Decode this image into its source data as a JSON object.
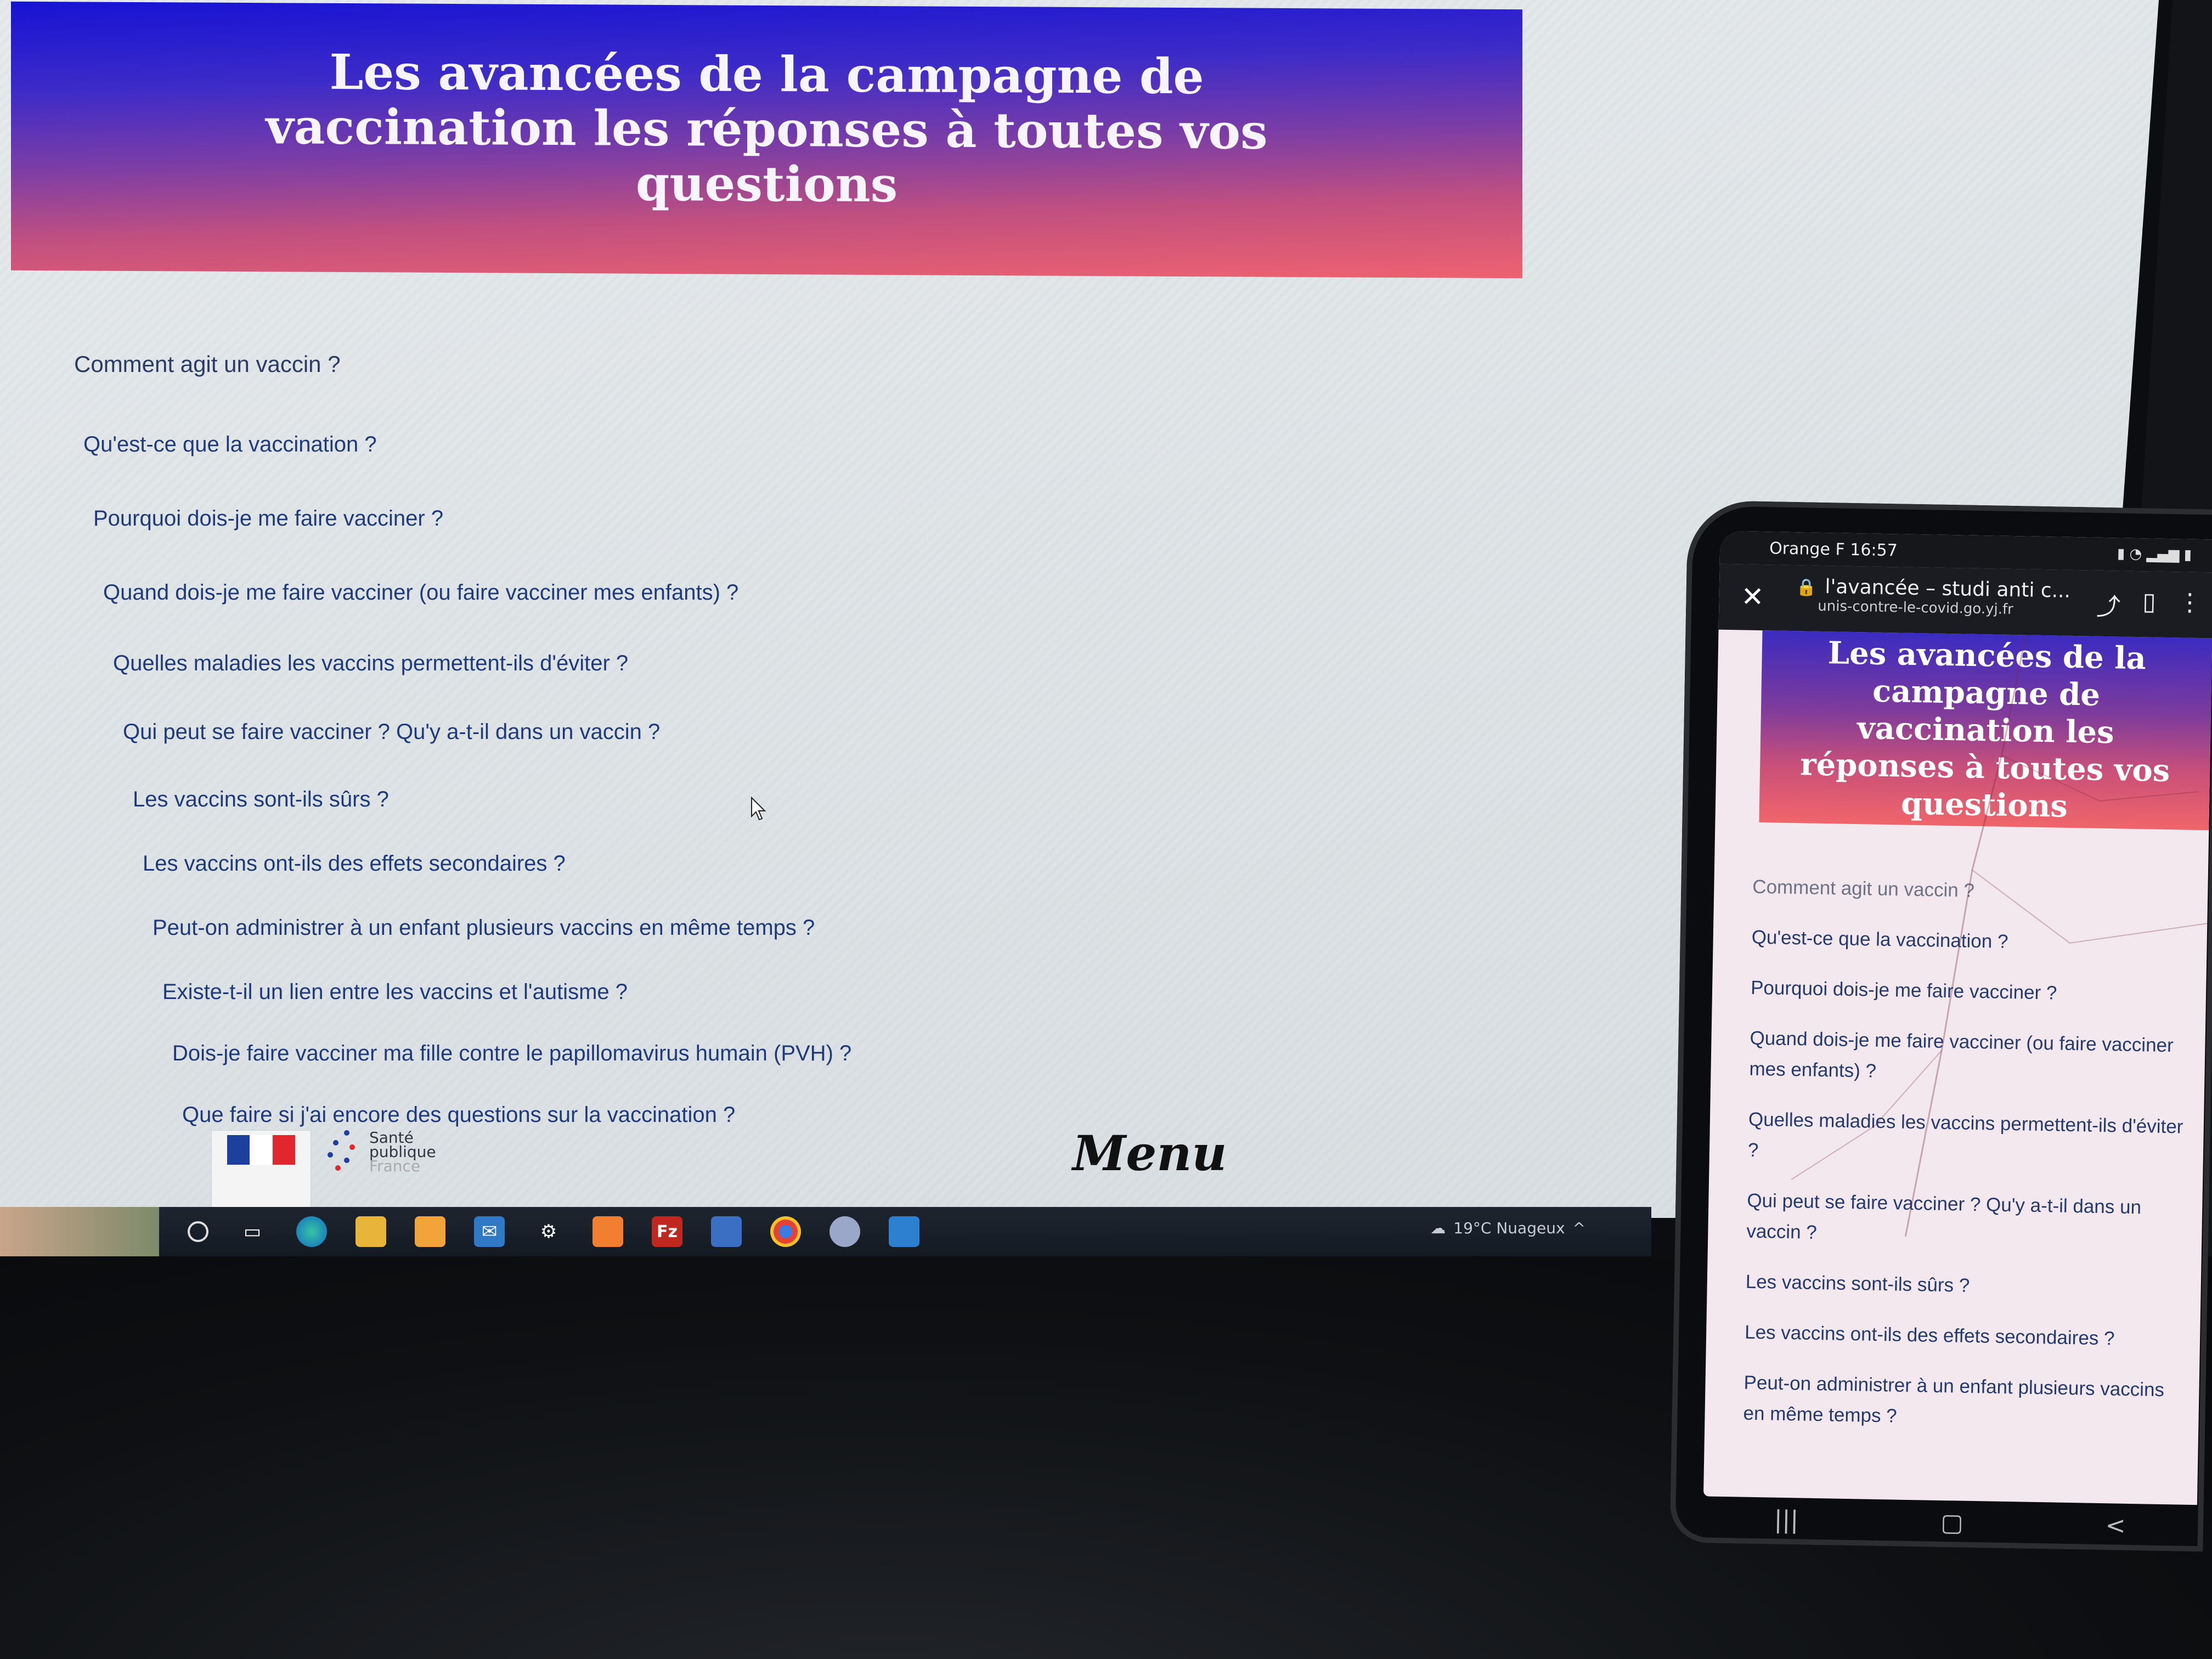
{
  "desktop": {
    "hero_title": "Les avancées de la campagne de vaccination les réponses à toutes vos questions",
    "faq": [
      "Comment agit un vaccin ?",
      "Qu'est-ce que la vaccination ?",
      "Pourquoi dois-je me faire vacciner ?",
      "Quand dois-je me faire vacciner (ou faire vacciner mes enfants) ?",
      "Quelles maladies les vaccins permettent-ils d'éviter ?",
      "Qui peut se faire vacciner ? Qu'y a-t-il dans un vaccin ?",
      "Les vaccins sont-ils sûrs ?",
      "Les vaccins ont-ils des effets secondaires ?",
      "Peut-on administrer à un enfant plusieurs vaccins en même temps ?",
      "Existe-t-il un lien entre les vaccins et l'autisme ?",
      "Dois-je faire vacciner ma fille contre le papillomavirus humain (PVH) ?",
      "Que faire si j'ai encore des questions sur la vaccination ?"
    ],
    "logo_sante_line1": "Santé",
    "logo_sante_line2": "publique",
    "logo_sante_line3": "France",
    "menu_label": "Menu",
    "taskbar": {
      "weather": "19°C  Nuageux",
      "icons": [
        "search-circle-icon",
        "task-view-icon",
        "edge-icon",
        "file-explorer-icon",
        "store-icon",
        "mail-icon",
        "settings-icon",
        "xampp-icon",
        "filezilla-icon",
        "notepad-icon",
        "chrome-icon",
        "cloud-app-icon",
        "calculator-icon"
      ]
    },
    "colors": {
      "hero_top": "#1713d4",
      "hero_bottom": "#ee6270",
      "link": "#1f3a7a"
    }
  },
  "phone": {
    "status": {
      "carrier_time": "Orange F 16:57"
    },
    "browser": {
      "tab_title": "l'avancée – studi anti c...",
      "domain": "unis-contre-le-covid.go.yj.fr"
    },
    "hero_title": "Les avancées de la campagne de vaccination les réponses à toutes vos questions",
    "faq": [
      "Comment agit un vaccin ?",
      "Qu'est-ce que la vaccination ?",
      "Pourquoi dois-je me faire vacciner ?",
      "Quand dois-je me faire vacciner (ou faire vacciner mes enfants) ?",
      "Quelles maladies les vaccins permettent-ils d'éviter ?",
      "Qui peut se faire vacciner ? Qu'y a-t-il dans un vaccin ?",
      "Les vaccins sont-ils sûrs ?",
      "Les vaccins ont-ils des effets secondaires ?",
      "Peut-on administrer à un enfant plusieurs vaccins en même temps ?"
    ]
  }
}
